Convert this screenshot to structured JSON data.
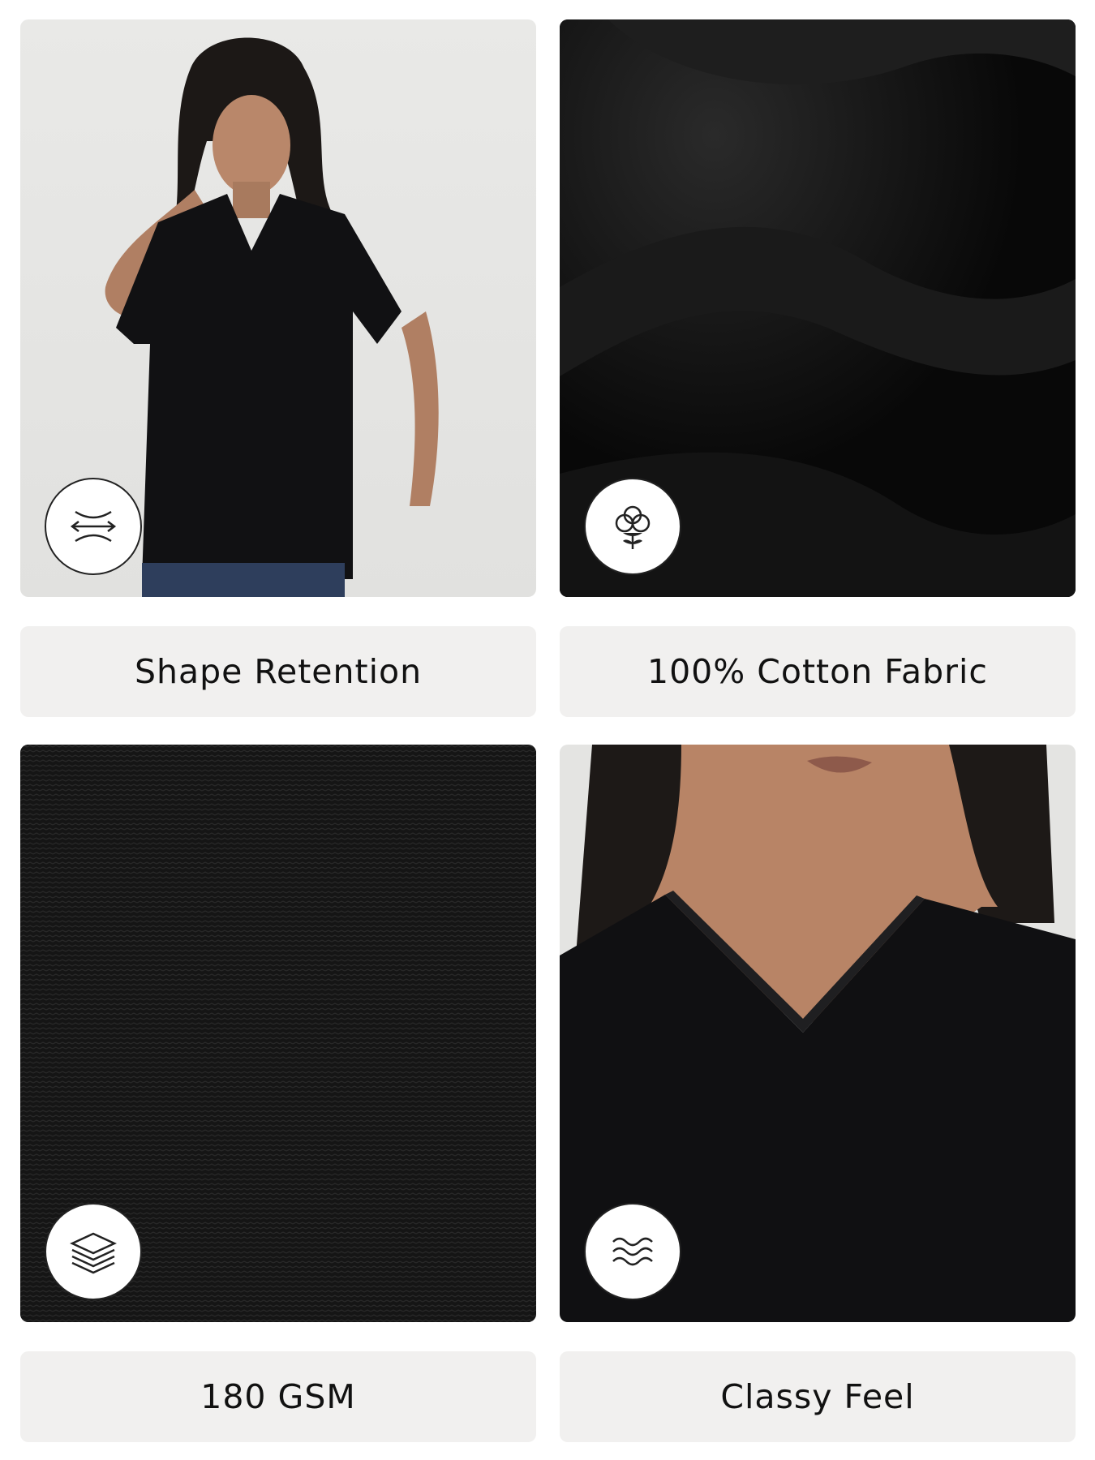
{
  "features": [
    {
      "label": "Shape Retention",
      "icon": "stretch-arrows-icon"
    },
    {
      "label": "100% Cotton Fabric",
      "icon": "cotton-flower-icon"
    },
    {
      "label": "180 GSM",
      "icon": "layers-icon"
    },
    {
      "label": "Classy Feel",
      "icon": "waves-icon"
    }
  ],
  "colors": {
    "label_bg": "#f1f0ef",
    "fabric": "#0b0b0b",
    "text": "#111111"
  }
}
